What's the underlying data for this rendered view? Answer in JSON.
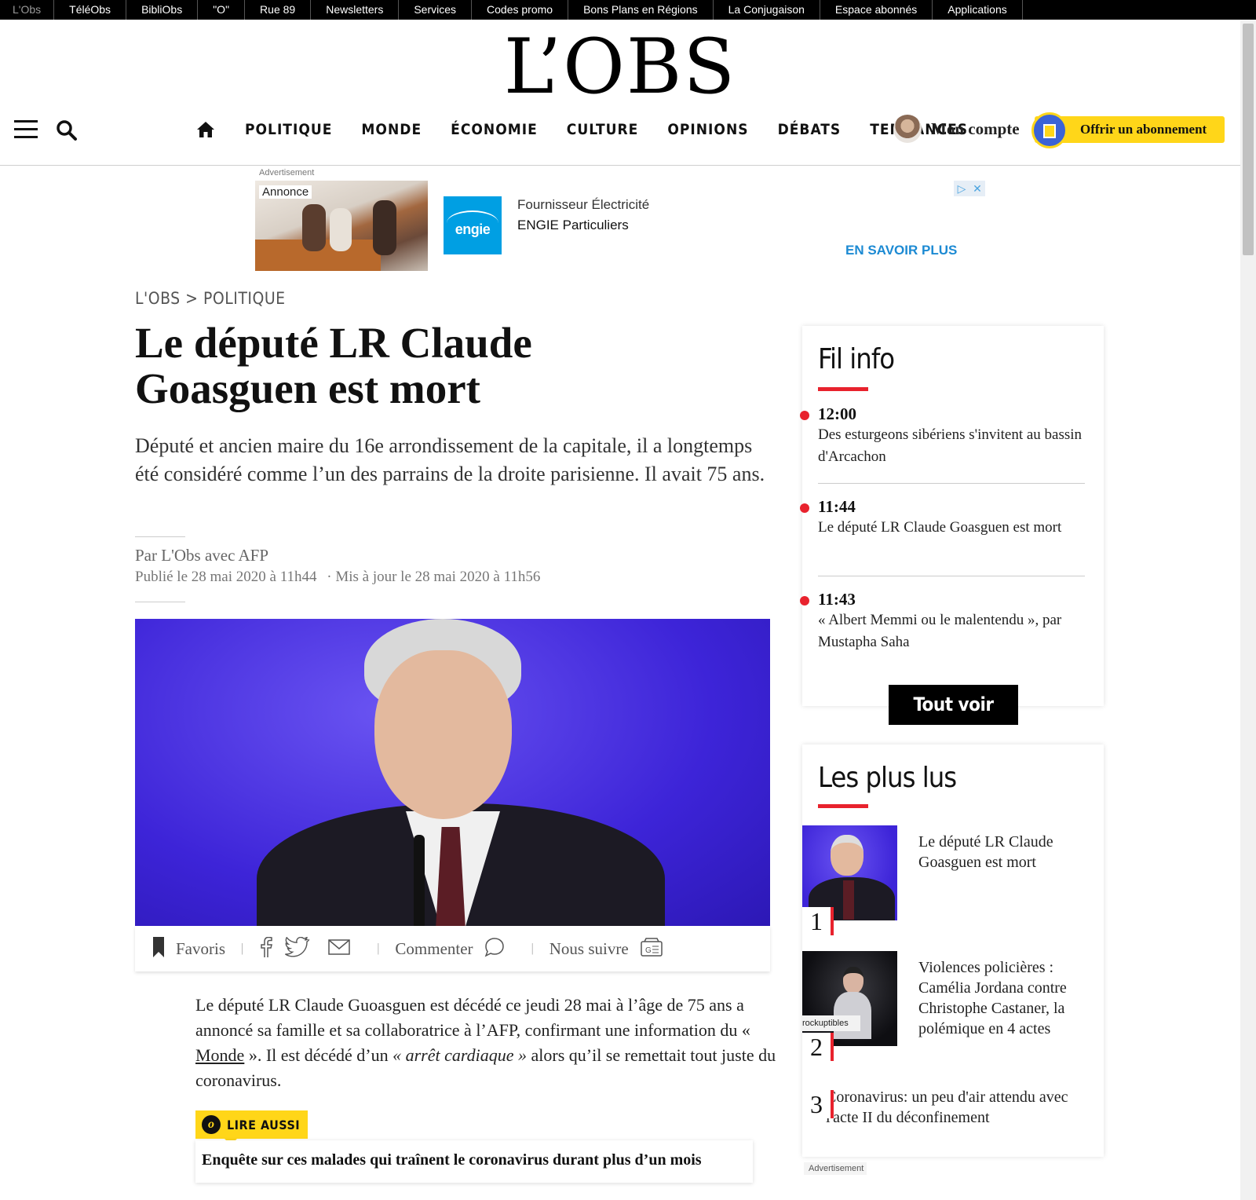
{
  "network_bar": {
    "items": [
      "L'Obs",
      "TéléObs",
      "BibliObs",
      "\"O\"",
      "Rue 89",
      "Newsletters",
      "Services",
      "Codes promo",
      "Bons Plans en Régions",
      "La Conjugaison",
      "Espace abonnés",
      "Applications"
    ]
  },
  "header": {
    "logo": "L’OBS",
    "menu_icon": "hamburger-menu-icon",
    "search_icon": "search-icon",
    "home_icon": "home-icon",
    "nav": [
      "POLITIQUE",
      "MONDE",
      "ÉCONOMIE",
      "CULTURE",
      "OPINIONS",
      "DÉBATS",
      "TENDANCES"
    ],
    "account_label": "Mon compte",
    "offer_label": "Offrir un abonnement"
  },
  "ad": {
    "label": "Advertisement",
    "badge": "Annonce",
    "brand_logo": "engie",
    "title": "Fournisseur Électricité",
    "brand": "ENGIE Particuliers",
    "cta": "EN SAVOIR PLUS"
  },
  "article": {
    "breadcrumb": "L'OBS > POLITIQUE",
    "title": "Le député LR Claude Goasguen est mort",
    "lede": "Député et ancien maire du 16e arrondissement de la capitale, il a longtemps été considéré comme l’un des parrains de la droite parisienne. Il avait 75 ans.",
    "byline": "Par L'Obs avec AFP",
    "published": "Publié le 28 mai 2020 à 11h44",
    "updated": "· Mis à jour le 28 mai 2020 à 11h56",
    "share": {
      "favoris": "Favoris",
      "commenter": "Commenter",
      "nous_suivre": "Nous suivre"
    },
    "body_part1": "Le député LR Claude Guoasguen est décédé ce jeudi 28 mai à l’âge de 75 ans a annoncé sa famille et sa collaboratrice à l’AFP, confirmant une information du « ",
    "body_link": "Monde",
    "body_part2": " ». Il est décédé d’un ",
    "body_quote": "« arrêt cardiaque »",
    "body_part3": " alors qu’il se remettait tout juste du coronavirus.",
    "lire_aussi_label": "LIRE AUSSI",
    "related_title": "Enquête sur ces malades qui traînent le coronavirus durant plus d’un mois"
  },
  "fil_info": {
    "title": "Fil info",
    "items": [
      {
        "time": "12:00",
        "text": "Des esturgeons sibériens s'invitent au bassin d'Arcachon"
      },
      {
        "time": "11:44",
        "text": "Le député LR Claude Goasguen est mort"
      },
      {
        "time": "11:43",
        "text": "« Albert Memmi ou le malentendu », par Mustapha Saha"
      }
    ],
    "button": "Tout voir"
  },
  "les_plus_lus": {
    "title": "Les plus lus",
    "items": [
      {
        "rank": "1",
        "text": "Le député LR Claude Goasguen est mort"
      },
      {
        "rank": "2",
        "text": "Violences policières : Camélia Jordana contre Christophe Castaner, la polémique en 4 actes",
        "thumb_caption": "rockuptibles"
      },
      {
        "rank": "3",
        "text": "Coronavirus: un peu d'air attendu avec l'acte II du déconfinement"
      }
    ]
  },
  "sidebar_ad_label": "Advertisement",
  "colors": {
    "accent_red": "#e8222d",
    "offer_yellow": "#ffd619",
    "hero_blue": "#4a2ee8",
    "engie_blue": "#009fe3"
  }
}
